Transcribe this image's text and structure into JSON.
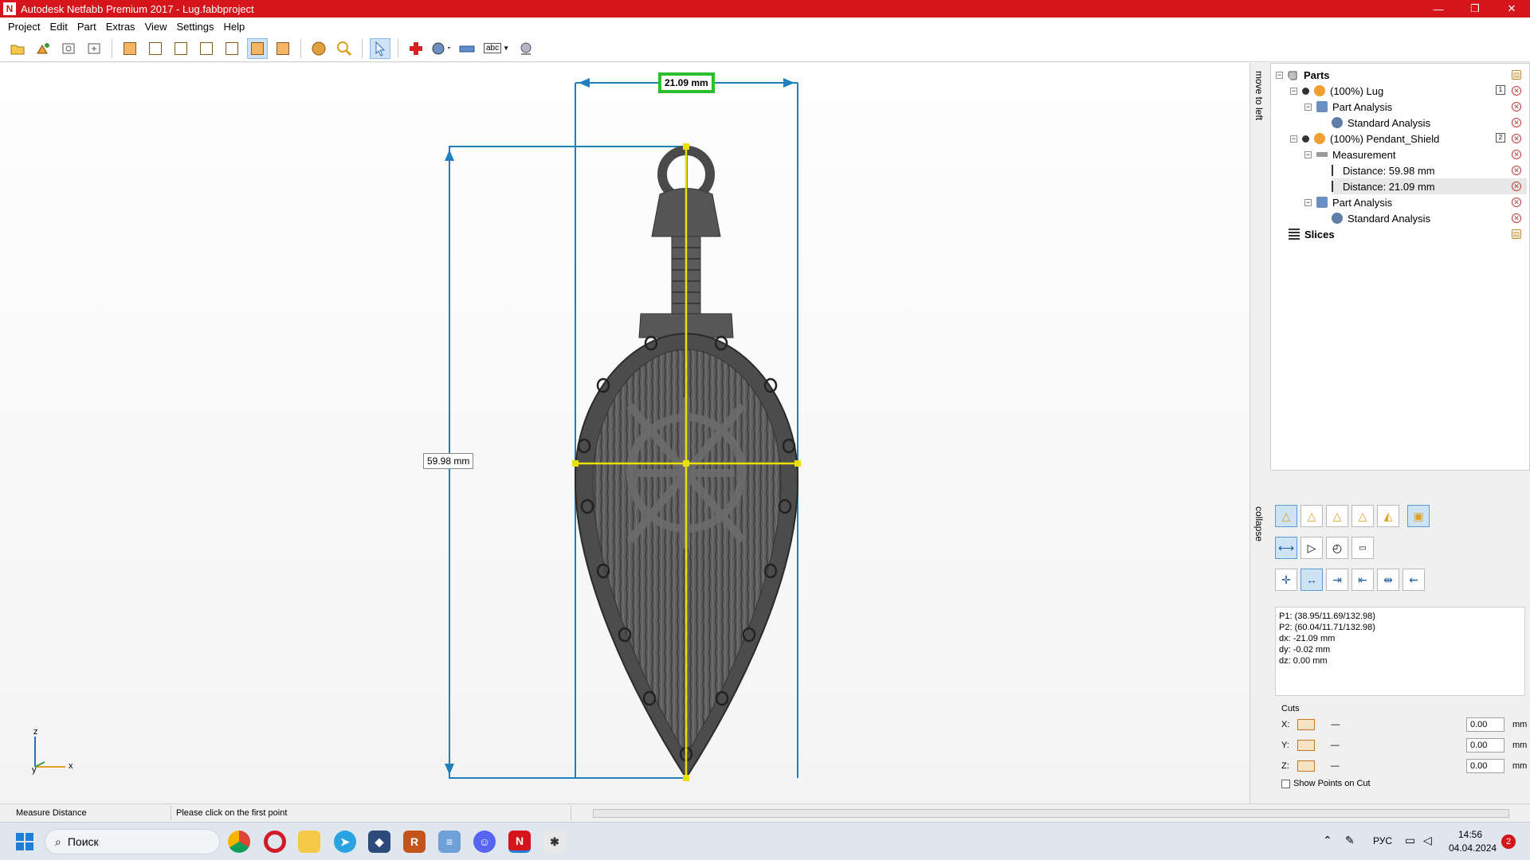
{
  "window": {
    "title": "Autodesk Netfabb Premium 2017 - Lug.fabbproject",
    "app_icon": "N",
    "minimize": "—",
    "maximize": "❐",
    "close": "✕"
  },
  "menu": [
    "Project",
    "Edit",
    "Part",
    "Extras",
    "View",
    "Settings",
    "Help"
  ],
  "toolbar": {
    "text_tool_label": "abc"
  },
  "viewport": {
    "width_label": "21.09 mm",
    "height_label": "59.98 mm",
    "axis": {
      "z": "z",
      "x": "x",
      "y": "y"
    }
  },
  "side_tabs": {
    "move_to_left": "move to left",
    "collapse": "collapse"
  },
  "tree": [
    {
      "label": "Parts",
      "level": 0,
      "bold": true
    },
    {
      "label": "(100%) Lug",
      "level": 1,
      "badge": "1"
    },
    {
      "label": "Part Analysis",
      "level": 2
    },
    {
      "label": "Standard Analysis",
      "level": 3
    },
    {
      "label": "(100%) Pendant_Shield",
      "level": 1,
      "badge": "2"
    },
    {
      "label": "Measurement",
      "level": 2
    },
    {
      "label": "Distance: 59.98 mm",
      "level": 3
    },
    {
      "label": "Distance: 21.09 mm",
      "level": 3,
      "selected": true
    },
    {
      "label": "Part Analysis",
      "level": 2
    },
    {
      "label": "Standard Analysis",
      "level": 3
    },
    {
      "label": "Slices",
      "level": 0,
      "bold": true
    }
  ],
  "measurement": {
    "p1": "P1: (38.95/11.69/132.98)",
    "p2": "P2: (60.04/11.71/132.98)",
    "dx": "dx: -21.09 mm",
    "dy": "dy: -0.02 mm",
    "dz": "dz: 0.00 mm"
  },
  "cuts": {
    "title": "Cuts",
    "rows": [
      {
        "axis": "X:",
        "value": "0.00",
        "unit": "mm"
      },
      {
        "axis": "Y:",
        "value": "0.00",
        "unit": "mm"
      },
      {
        "axis": "Z:",
        "value": "0.00",
        "unit": "mm"
      }
    ],
    "show_points_label": "Show Points on Cut"
  },
  "status": {
    "mode": "Measure Distance",
    "hint": "Please click on the first point"
  },
  "taskbar": {
    "search_label": "Поиск",
    "lang": "РУС",
    "time": "14:56",
    "date": "04.04.2024",
    "notifications": "2"
  },
  "colors": {
    "accent_titlebar": "#d5141b",
    "measure_blue": "#1f7fbf",
    "measure_yellow": "#e8e000",
    "highlight_green": "#2bbf2b"
  }
}
